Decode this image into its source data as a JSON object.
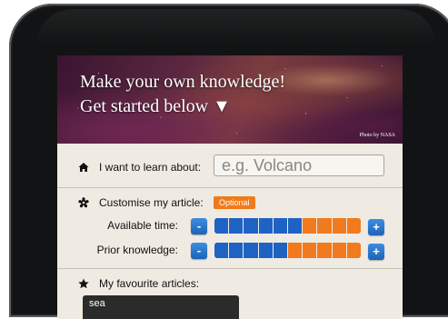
{
  "hero": {
    "title_line1": "Make your own knowledge!",
    "title_line2": "Get started below ▼",
    "credit": "Photo by NASA"
  },
  "learn": {
    "label": "I want to learn about:",
    "placeholder": "e.g. Volcano",
    "value": ""
  },
  "customise": {
    "label": "Customise my article:",
    "badge": "Optional",
    "available_time": {
      "label": "Available time:",
      "level": 6,
      "segments": 10,
      "decrease": "-",
      "increase": "+"
    },
    "prior_knowledge": {
      "label": "Prior knowledge:",
      "level": 5,
      "segments": 10,
      "decrease": "-",
      "increase": "+"
    }
  },
  "favourites": {
    "label": "My favourite articles:",
    "items": [
      "sea"
    ]
  },
  "colors": {
    "bar_active": "#1e62c3",
    "bar_inactive": "#f07a1d",
    "badge": "#f07b1a",
    "screen_bg": "#efebe3"
  },
  "icons": {
    "learn": "house-icon",
    "customise": "gear-flower-icon",
    "favourites": "star-icon"
  }
}
